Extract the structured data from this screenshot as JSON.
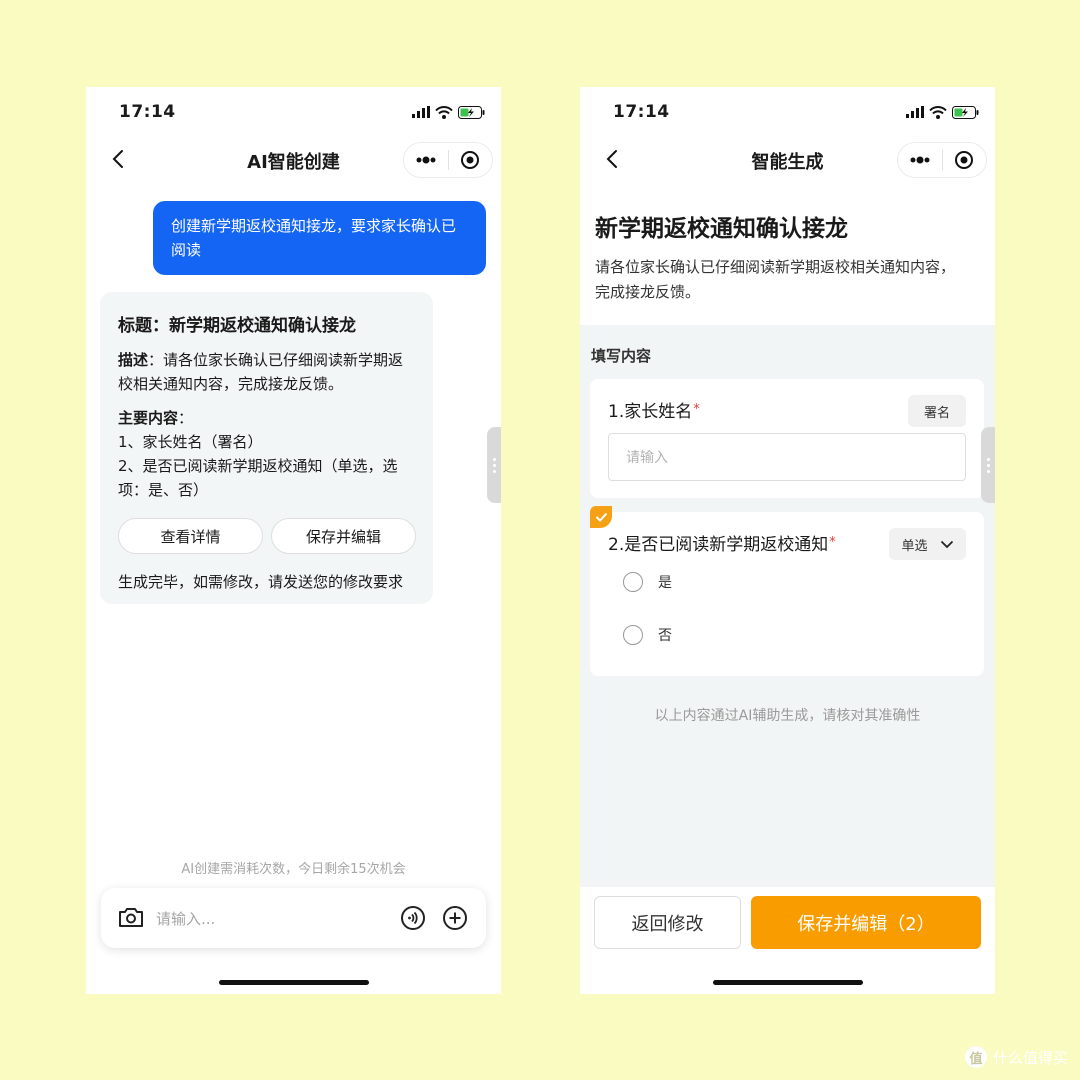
{
  "left": {
    "status": {
      "time": "17:14"
    },
    "nav": {
      "title": "AI智能创建"
    },
    "user_message": "创建新学期返校通知接龙，要求家长确认已阅读",
    "ai_card": {
      "title": "标题：新学期返校通知确认接龙",
      "desc_label": "描述",
      "desc_text": "：请各位家长确认已仔细阅读新学期返校相关通知内容，完成接龙反馈。",
      "main_label": "主要内容",
      "main_colon": "：",
      "item1": "1、家长姓名（署名）",
      "item2": "2、是否已阅读新学期返校通知（单选，选项：是、否）",
      "btn_view": "查看详情",
      "btn_save": "保存并编辑",
      "note": "生成完毕，如需修改，请发送您的修改要求"
    },
    "quota": "AI创建需消耗次数，今日剩余15次机会",
    "input_placeholder": "请输入..."
  },
  "right": {
    "status": {
      "time": "17:14"
    },
    "nav": {
      "title": "智能生成"
    },
    "form_title": "新学期返校通知确认接龙",
    "form_desc": "请各位家长确认已仔细阅读新学期返校相关通知内容，完成接龙反馈。",
    "section_label": "填写内容",
    "q1": {
      "label": "1.家长姓名",
      "required_mark": "*",
      "tag": "署名",
      "placeholder": "请输入"
    },
    "q2": {
      "label": "2.是否已阅读新学期返校通知",
      "required_mark": "*",
      "tag": "单选",
      "options": [
        "是",
        "否"
      ]
    },
    "ai_note": "以上内容通过AI辅助生成，请核对其准确性",
    "btn_back": "返回修改",
    "btn_save": "保存并编辑（2）"
  },
  "watermark": {
    "logo": "值",
    "text": "什么值得买"
  },
  "colors": {
    "background": "#f9fbc0",
    "blue": "#1565f5",
    "orange": "#f99c00",
    "required": "#e43c3c"
  },
  "icons": [
    "signal-icon",
    "wifi-icon",
    "battery-icon",
    "back-icon",
    "more-icon",
    "target-icon",
    "camera-icon",
    "voice-icon",
    "plus-icon",
    "check-icon",
    "chevron-down-icon"
  ]
}
